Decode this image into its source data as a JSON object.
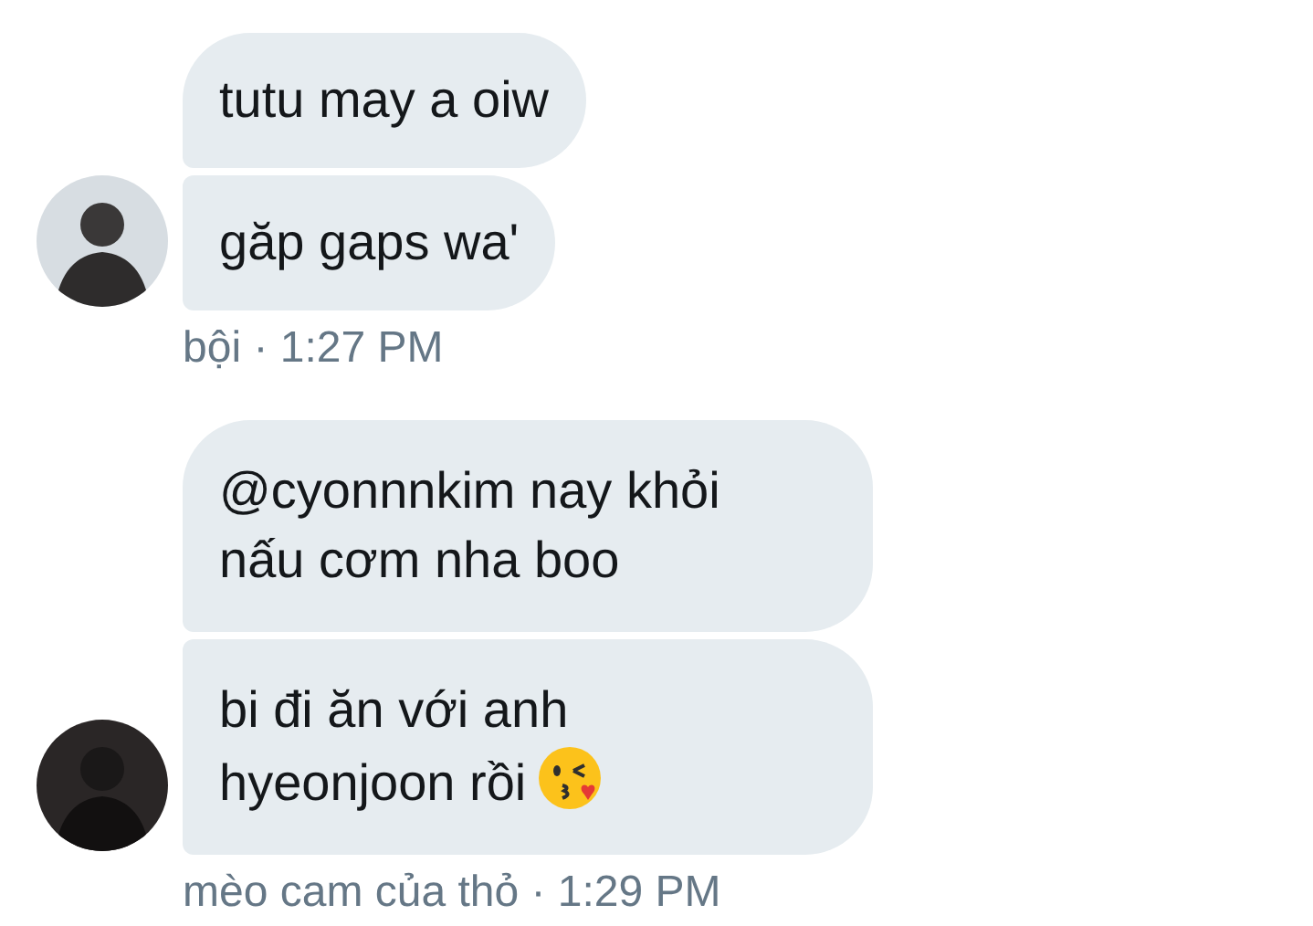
{
  "groups": [
    {
      "avatar": {
        "kind": "light"
      },
      "messages": [
        {
          "text": "tutu may a oiw"
        },
        {
          "text": "găp gaps wa'"
        }
      ],
      "meta": "bội · 1:27 PM"
    },
    {
      "avatar": {
        "kind": "dark"
      },
      "messages": [
        {
          "text": "@cyonnnkim nay khỏi\nnấu cơm nha boo"
        },
        {
          "text": "bi đi ăn với anh\nhyeonjoon rồi",
          "emoji": {
            "kind": "wink-kiss"
          }
        }
      ],
      "meta": "mèo cam của thỏ · 1:29 PM"
    }
  ]
}
